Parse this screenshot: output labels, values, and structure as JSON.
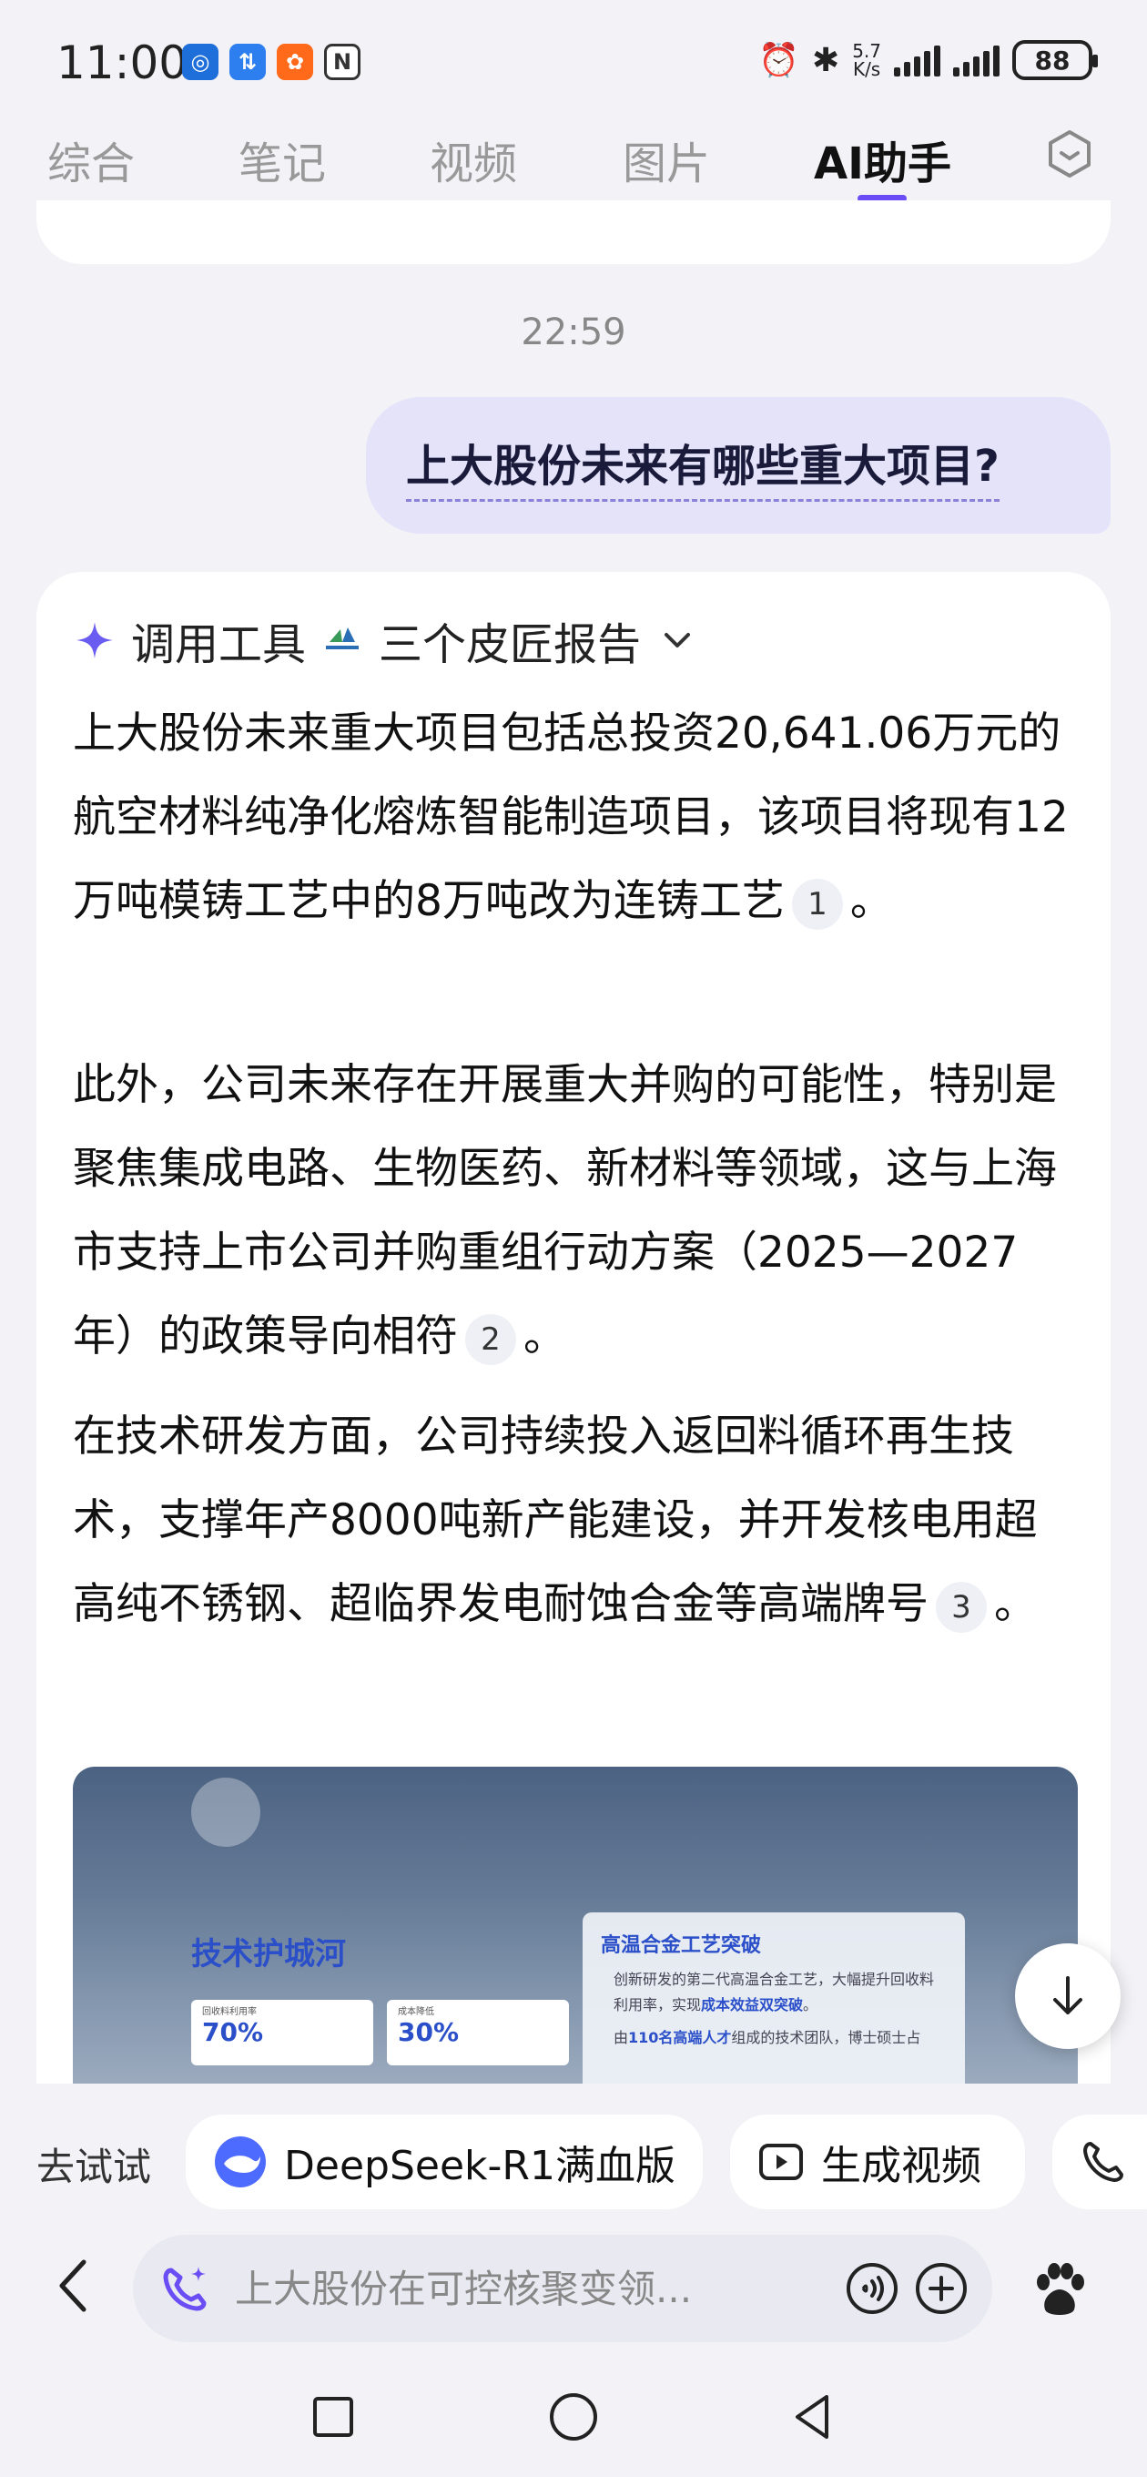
{
  "status_bar": {
    "time": "11:00",
    "net_speed": "5.7\nK/s",
    "battery": "88"
  },
  "tabs": [
    {
      "label": "综合"
    },
    {
      "label": "笔记"
    },
    {
      "label": "视频"
    },
    {
      "label": "图片"
    },
    {
      "label": "AI助手",
      "active": true
    }
  ],
  "chat": {
    "timestamp": "22:59",
    "user_message": "上大股份未来有哪些重大项目?",
    "tool_call": {
      "label": "调用工具",
      "source": "三个皮匠报告"
    },
    "paragraphs": [
      {
        "text": "上大股份未来重大项目包括总投资20,641.06万元的航空材料纯净化熔炼智能制造项目，该项目将现有12万吨模铸工艺中的8万吨改为连铸工艺",
        "cite": "1",
        "end": "。"
      },
      {
        "text": "此外，公司未来存在开展重大并购的可能性，特别是聚焦集成电路、生物医药、新材料等领域，这与上海市支持上市公司并购重组行动方案（2025—2027年）的政策导向相符",
        "cite": "2",
        "end": "。"
      },
      {
        "text": "在技术研发方面，公司持续投入返回料循环再生技术，支撑年产8000吨新产能建设，并开发核电用超高纯不锈钢、超临界发电耐蚀合金等高端牌号",
        "cite": "3",
        "end": "。"
      }
    ],
    "image_card": {
      "title": "技术护城河",
      "stat1_label": "回收料利用率",
      "stat1_value": "70%",
      "stat2_label": "成本降低",
      "stat2_value": "30%",
      "panel_title": "高温合金工艺突破",
      "panel_line1_a": "创新研发的第二代高温合金工艺，大幅提升回收料利用率，实现",
      "panel_line1_b": "成本效益双突破",
      "panel_line1_c": "。",
      "panel_line2_a": "由",
      "panel_line2_b": "110名高端人才",
      "panel_line2_c": "组成的技术团队，博士硕士占"
    }
  },
  "try_bar": {
    "label": "去试试",
    "chips": [
      {
        "label": "DeepSeek-R1满血版"
      },
      {
        "label": "生成视频"
      }
    ]
  },
  "input": {
    "placeholder": "上大股份在可控核聚变领..."
  },
  "colors": {
    "accent": "#6a4df4",
    "user_bubble": "#e4e3fa",
    "link_blue": "#2b4fc9",
    "background": "#f2f2f7"
  }
}
